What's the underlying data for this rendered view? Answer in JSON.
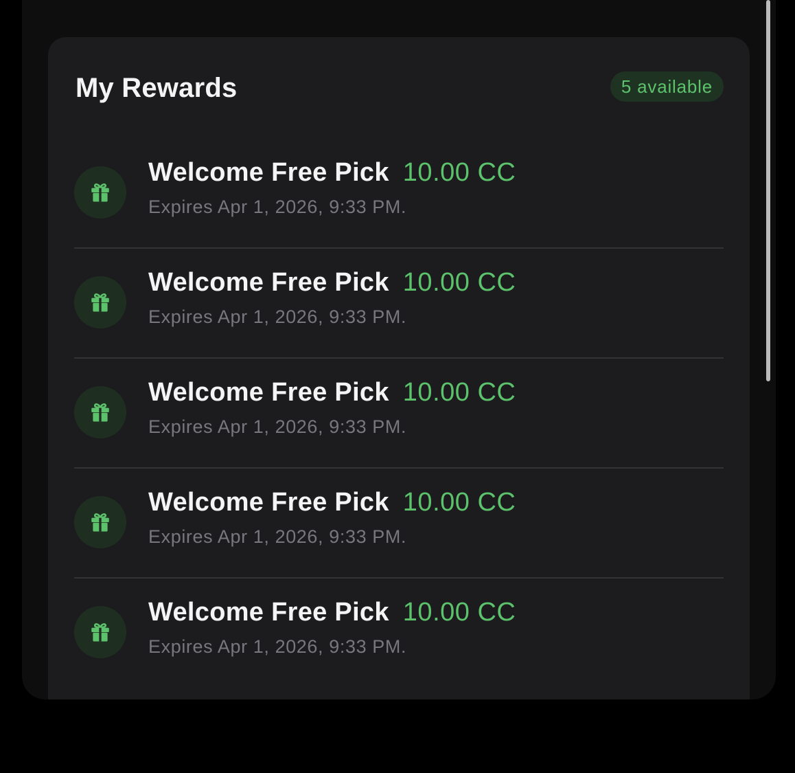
{
  "rewards": {
    "title": "My Rewards",
    "badge": "5 available",
    "accent_color": "#5cc26b",
    "icon": "gift-icon",
    "items": [
      {
        "title": "Welcome Free Pick",
        "amount": "10.00 CC",
        "expiry": "Expires Apr 1, 2026, 9:33 PM."
      },
      {
        "title": "Welcome Free Pick",
        "amount": "10.00 CC",
        "expiry": "Expires Apr 1, 2026, 9:33 PM."
      },
      {
        "title": "Welcome Free Pick",
        "amount": "10.00 CC",
        "expiry": "Expires Apr 1, 2026, 9:33 PM."
      },
      {
        "title": "Welcome Free Pick",
        "amount": "10.00 CC",
        "expiry": "Expires Apr 1, 2026, 9:33 PM."
      },
      {
        "title": "Welcome Free Pick",
        "amount": "10.00 CC",
        "expiry": "Expires Apr 1, 2026, 9:33 PM."
      }
    ]
  }
}
